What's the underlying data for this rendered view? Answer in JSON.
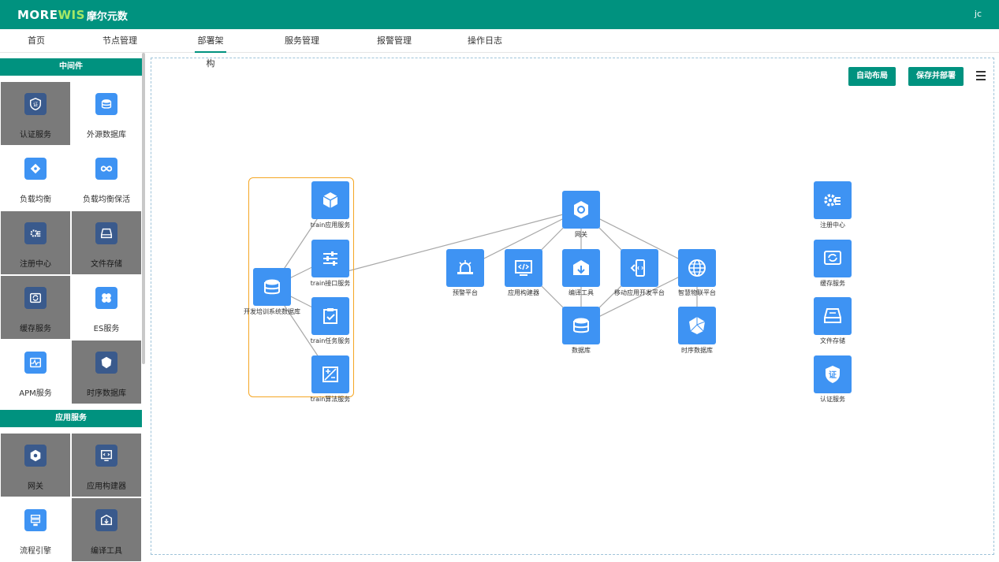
{
  "header": {
    "brand_main": "MOREWIS",
    "brand_accent": "WIS",
    "brand_cn": "摩尔元数",
    "user": "jc",
    "color": "#00927f"
  },
  "nav": {
    "items": [
      "首页",
      "节点管理",
      "部署架构",
      "服务管理",
      "报警管理",
      "操作日志"
    ],
    "active": "部署架构"
  },
  "sidebar": {
    "middleware_title": "中间件",
    "middleware": [
      {
        "label": "认证服务",
        "icon": "certificate-icon",
        "selected": true
      },
      {
        "label": "外源数据库",
        "icon": "database-icon",
        "selected": false
      },
      {
        "label": "负载均衡",
        "icon": "load-balance-icon",
        "selected": false
      },
      {
        "label": "负载均衡保活",
        "icon": "infinity-icon",
        "selected": false
      },
      {
        "label": "注册中心",
        "icon": "gear-list-icon",
        "selected": true
      },
      {
        "label": "文件存储",
        "icon": "storage-drive-icon",
        "selected": true
      },
      {
        "label": "缓存服务",
        "icon": "refresh-icon",
        "selected": true
      },
      {
        "label": "ES服务",
        "icon": "flower-icon",
        "selected": false
      },
      {
        "label": "APM服务",
        "icon": "pulse-icon",
        "selected": false
      },
      {
        "label": "时序数据库",
        "icon": "polyhedron-icon",
        "selected": true
      }
    ],
    "apps_title": "应用服务",
    "apps": [
      {
        "label": "网关",
        "icon": "gateway-icon",
        "selected": true
      },
      {
        "label": "应用构建器",
        "icon": "code-monitor-icon",
        "selected": true
      },
      {
        "label": "流程引擎",
        "icon": "flow-icon",
        "selected": false
      },
      {
        "label": "编译工具",
        "icon": "box-arrow-icon",
        "selected": true
      }
    ]
  },
  "toolbar": {
    "auto_layout": "自动布局",
    "save_deploy": "保存并部署"
  },
  "diagram": {
    "group": [
      {
        "label": "train应用服务",
        "icon": "cube-icon"
      },
      {
        "label": "train接口服务",
        "icon": "sliders-icon"
      },
      {
        "label": "train任务服务",
        "icon": "clipboard-check-icon"
      },
      {
        "label": "train算法服务",
        "icon": "plus-minus-icon"
      }
    ],
    "training_db": "开发培训系统数据库",
    "gateway": "网关",
    "apps": [
      "预警平台",
      "应用构建器",
      "编译工具",
      "移动应用开发平台",
      "智慧物联平台"
    ],
    "database": "数据库",
    "tsdb": "时序数据库",
    "services": [
      "注册中心",
      "缓存服务",
      "文件存储",
      "认证服务"
    ],
    "line_color": "#a8a8a8",
    "node_color": "#3e93f3",
    "group_border": "#f5a623"
  }
}
